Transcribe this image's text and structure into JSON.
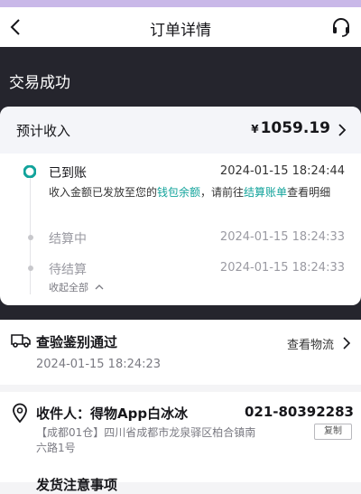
{
  "nav": {
    "title": "订单详情",
    "back_icon": "back-arrow-icon",
    "service_icon": "headset-icon"
  },
  "status": {
    "title": "交易成功"
  },
  "income": {
    "label": "预计收入",
    "currency": "¥",
    "amount": "1059.19"
  },
  "timeline": [
    {
      "title": "已到账",
      "time": "2024-01-15 18:24:44",
      "active": true,
      "desc_prefix": "收入金额已发放至您的",
      "desc_link1": "钱包余额",
      "desc_mid": "，请前往",
      "desc_link2": "结算账单",
      "desc_suffix": "查看明细"
    },
    {
      "title": "结算中",
      "time": "2024-01-15 18:24:33",
      "active": false
    },
    {
      "title": "待结算",
      "time": "2024-01-15 18:24:33",
      "active": false
    }
  ],
  "collapse_label": "收起全部",
  "inspection": {
    "title": "查验鉴别通过",
    "time": "2024-01-15 18:24:23",
    "logistics_label": "查看物流"
  },
  "receiver": {
    "label": "收件人：得物App白冰冰",
    "phone": "021-80392283",
    "address_line1": "【成都01仓】四川省成都市龙泉驿区柏合镇南",
    "address_line2": "六路1号",
    "copy_label": "复制"
  },
  "next_section": {
    "title": "发货注意事项"
  },
  "colors": {
    "accent": "#12a39b",
    "dark_bg": "#25252d",
    "header_bg": "#f4f5f9"
  }
}
